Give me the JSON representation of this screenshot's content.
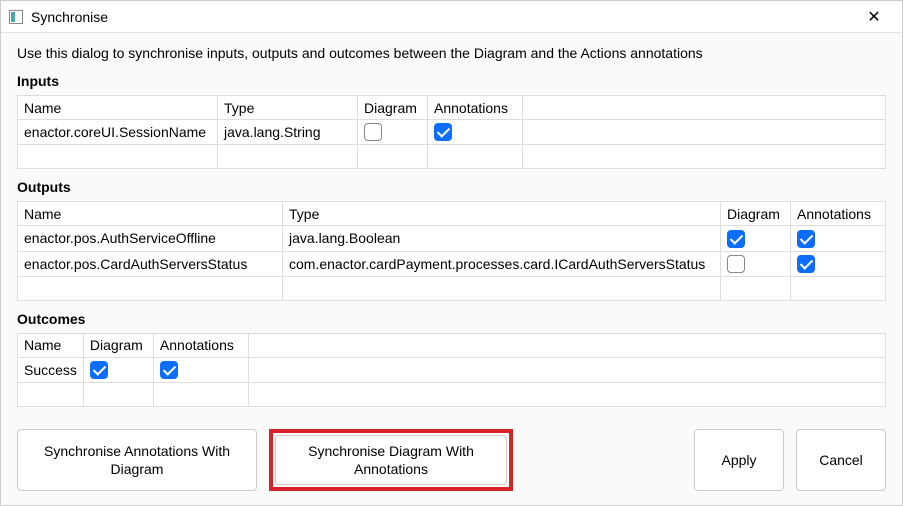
{
  "titlebar": {
    "title": "Synchronise"
  },
  "description": "Use this dialog to synchronise inputs, outputs and outcomes between the Diagram and the Actions annotations",
  "inputs": {
    "label": "Inputs",
    "headers": {
      "name": "Name",
      "type": "Type",
      "diagram": "Diagram",
      "annotations": "Annotations"
    },
    "rows": [
      {
        "name": "enactor.coreUI.SessionName",
        "type": "java.lang.String",
        "diagram": false,
        "annotations": true
      }
    ]
  },
  "outputs": {
    "label": "Outputs",
    "headers": {
      "name": "Name",
      "type": "Type",
      "diagram": "Diagram",
      "annotations": "Annotations"
    },
    "rows": [
      {
        "name": "enactor.pos.AuthServiceOffline",
        "type": "java.lang.Boolean",
        "diagram": true,
        "annotations": true
      },
      {
        "name": "enactor.pos.CardAuthServersStatus",
        "type": "com.enactor.cardPayment.processes.card.ICardAuthServersStatus",
        "diagram": false,
        "annotations": true
      }
    ]
  },
  "outcomes": {
    "label": "Outcomes",
    "headers": {
      "name": "Name",
      "diagram": "Diagram",
      "annotations": "Annotations"
    },
    "rows": [
      {
        "name": "Success",
        "diagram": true,
        "annotations": true
      }
    ]
  },
  "buttons": {
    "syncAnnotations": "Synchronise Annotations With Diagram",
    "syncDiagram": "Synchronise Diagram With Annotations",
    "apply": "Apply",
    "cancel": "Cancel"
  }
}
